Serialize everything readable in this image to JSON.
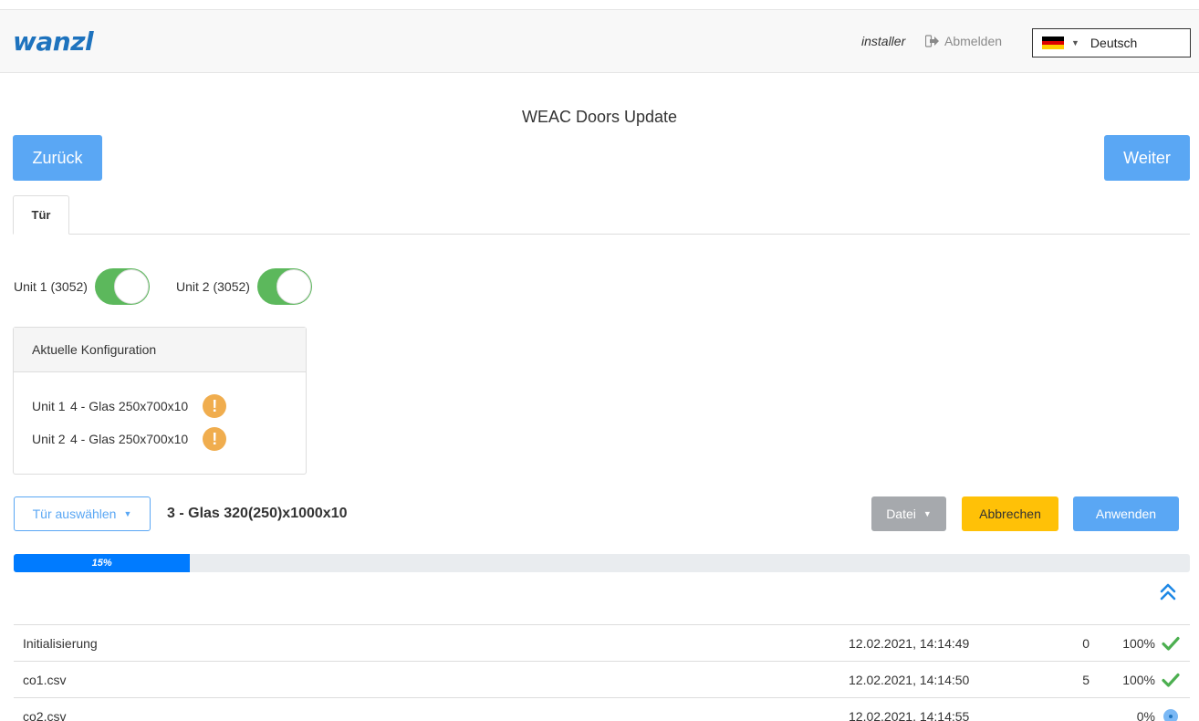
{
  "header": {
    "logo": "wanzl",
    "user": "installer",
    "logout_label": "Abmelden",
    "language": {
      "selected": "Deutsch",
      "flag_icon": "flag-de-icon"
    }
  },
  "page": {
    "title": "WEAC Doors Update",
    "back_label": "Zurück",
    "next_label": "Weiter"
  },
  "tabs": [
    {
      "label": "Tür",
      "active": true
    }
  ],
  "units": [
    {
      "label": "Unit 1 (3052)",
      "enabled": true
    },
    {
      "label": "Unit 2 (3052)",
      "enabled": true
    }
  ],
  "config": {
    "heading": "Aktuelle Konfiguration",
    "rows": [
      {
        "unit": "Unit 1",
        "value": "4 - Glas 250x700x10",
        "warning": "!"
      },
      {
        "unit": "Unit 2",
        "value": "4 - Glas 250x700x10",
        "warning": "!"
      }
    ]
  },
  "actions": {
    "door_select_label": "Tür auswählen",
    "selected_door": "3 - Glas 320(250)x1000x10",
    "file_label": "Datei",
    "cancel_label": "Abbrechen",
    "apply_label": "Anwenden"
  },
  "progress": {
    "percent": 15,
    "label": "15%"
  },
  "log": [
    {
      "name": "Initialisierung",
      "time": "12.02.2021, 14:14:49",
      "count": "0",
      "percent": "100%",
      "status": "done"
    },
    {
      "name": "co1.csv",
      "time": "12.02.2021, 14:14:50",
      "count": "5",
      "percent": "100%",
      "status": "done"
    },
    {
      "name": "co2.csv",
      "time": "12.02.2021, 14:14:55",
      "count": "",
      "percent": "0%",
      "status": "running"
    }
  ],
  "colors": {
    "primary": "#5aa7f4",
    "progress": "#007bff",
    "success": "#5cb85c",
    "warning": "#f0ad4e",
    "cancel": "#ffc107",
    "logo": "#1e73be"
  }
}
